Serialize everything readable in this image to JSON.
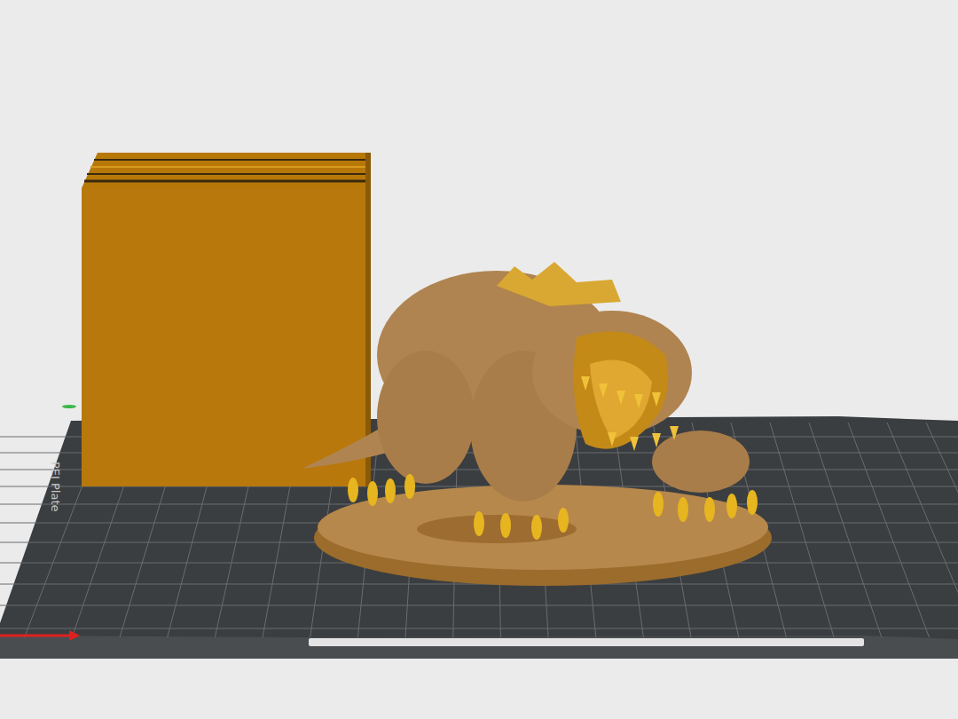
{
  "plate": {
    "label": "PEI Plate"
  }
}
